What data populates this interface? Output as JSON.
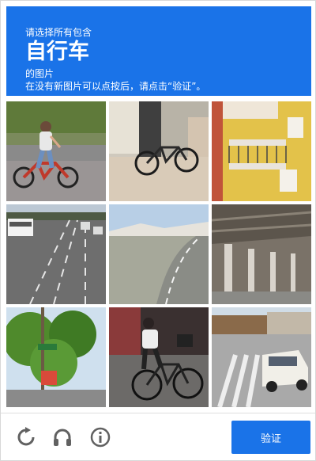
{
  "header": {
    "line1": "请选择所有包含",
    "target": "自行车",
    "line3": "的图片",
    "line4": "在没有新图片可以点按后，请点击“验证”。"
  },
  "colors": {
    "accent": "#1a73e8",
    "icon_gray": "#616161"
  },
  "tiles": [
    "cyclist-on-red-bike",
    "parked-bicycle-by-door",
    "apartment-balconies",
    "highway-with-bus",
    "curving-road",
    "overpass-underside",
    "trees-and-street-sign",
    "man-riding-bicycle",
    "white-car-at-crosswalk"
  ],
  "footer": {
    "reload_icon": "reload-icon",
    "audio_icon": "headphones-icon",
    "info_icon": "info-icon",
    "verify_label": "验证"
  }
}
